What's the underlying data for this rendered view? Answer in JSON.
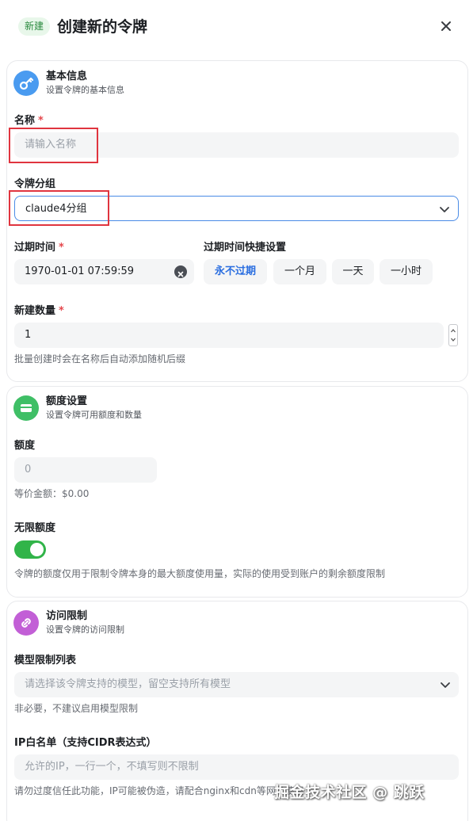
{
  "header": {
    "badge": "新建",
    "title": "创建新的令牌"
  },
  "basic": {
    "title": "基本信息",
    "subtitle": "设置令牌的基本信息",
    "name_label": "名称",
    "required_mark": "*",
    "name_placeholder": "请输入名称",
    "group_label": "令牌分组",
    "group_value": "claude4分组",
    "expire_label": "过期时间",
    "expire_value": "1970-01-01 07:59:59",
    "quick_label": "过期时间快捷设置",
    "quick_options": [
      "永不过期",
      "一个月",
      "一天",
      "一小时"
    ],
    "quick_selected": "永不过期",
    "count_label": "新建数量",
    "count_value": "1",
    "count_hint": "批量创建时会在名称后自动添加随机后缀"
  },
  "quota": {
    "title": "额度设置",
    "subtitle": "设置令牌可用额度和数量",
    "amount_label": "额度",
    "amount_placeholder": "0",
    "equiv_text": "等价金额：$0.00",
    "unlimited_label": "无限额度",
    "unlimited_on": true,
    "hint": "令牌的额度仅用于限制令牌本身的最大额度使用量，实际的使用受到账户的剩余额度限制"
  },
  "access": {
    "title": "访问限制",
    "subtitle": "设置令牌的访问限制",
    "model_label": "模型限制列表",
    "model_placeholder": "请选择该令牌支持的模型，留空支持所有模型",
    "model_hint": "非必要，不建议启用模型限制",
    "ip_label": "IP白名单（支持CIDR表达式）",
    "ip_placeholder": "允许的IP，一行一个，不填写则不限制",
    "ip_hint": "请勿过度信任此功能，IP可能被伪造，请配合nginx和cdn等网关使用"
  },
  "watermark": "掘金技术社区 @ 跳跃",
  "colors": {
    "accent": "#2a6ee0",
    "toggle_on": "#31b449",
    "highlight_box": "#e0353f",
    "basic_icon": "#4a9bf0",
    "quota_icon": "#3fbf66",
    "access_icon": "#c25fd6"
  },
  "icons": {
    "basic": "key-icon",
    "quota": "card-icon",
    "access": "link-icon",
    "close": "close-icon",
    "dropdown": "chevron-down-icon",
    "clear": "clear-icon"
  }
}
